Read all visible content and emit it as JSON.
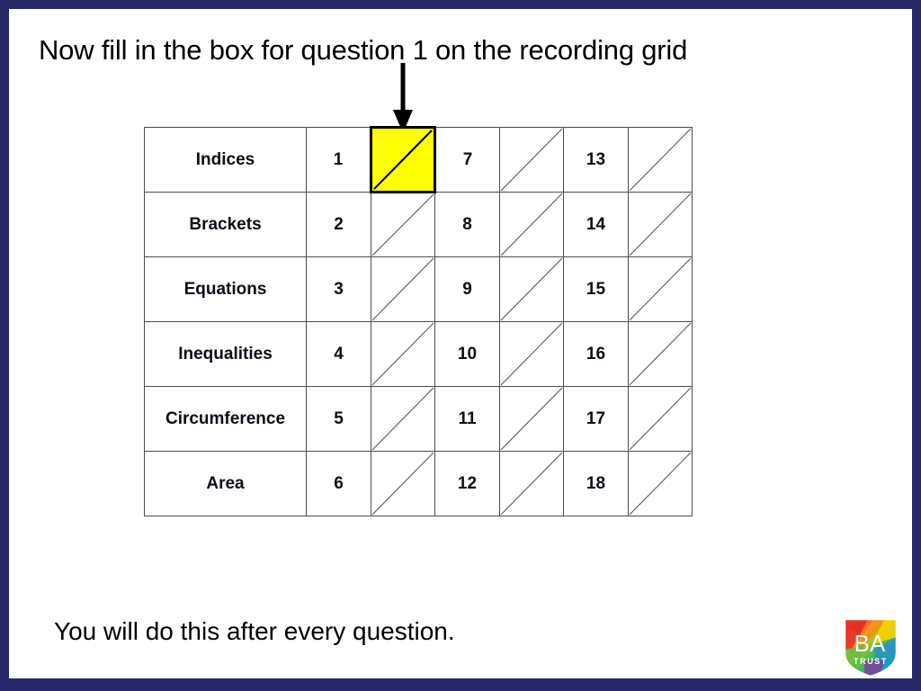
{
  "slide": {
    "headline": "Now fill in the box for question 1 on the recording grid",
    "footer_note": "You will do this after every question.",
    "border_color": "#27286a",
    "background_color": "#ffffff",
    "highlight_color": "#ffff00"
  },
  "arrow": {
    "name": "down-arrow",
    "points_to": "question-1-answer-cell"
  },
  "grid": {
    "rows": [
      {
        "topic": "Indices",
        "q1": "1",
        "a1": "",
        "q2": "7",
        "a2": "",
        "q3": "13",
        "a3": ""
      },
      {
        "topic": "Brackets",
        "q1": "2",
        "a1": "",
        "q2": "8",
        "a2": "",
        "q3": "14",
        "a3": ""
      },
      {
        "topic": "Equations",
        "q1": "3",
        "a1": "",
        "q2": "9",
        "a2": "",
        "q3": "15",
        "a3": ""
      },
      {
        "topic": "Inequalities",
        "q1": "4",
        "a1": "",
        "q2": "10",
        "a2": "",
        "q3": "16",
        "a3": ""
      },
      {
        "topic": "Circumference",
        "q1": "5",
        "a1": "",
        "q2": "11",
        "a2": "",
        "q3": "17",
        "a3": ""
      },
      {
        "topic": "Area",
        "q1": "6",
        "a1": "",
        "q2": "12",
        "a2": "",
        "q3": "18",
        "a3": ""
      }
    ],
    "highlighted_cell": {
      "row": 0,
      "column": "a1",
      "question_number": "1"
    }
  },
  "logo": {
    "name": "ba-trust-shield-logo",
    "primary_text": "BA",
    "secondary_text": "TRUST",
    "colors": [
      "#e3262a",
      "#f58220",
      "#ffd200",
      "#5bbb47",
      "#0fa8a0",
      "#2b8fd0",
      "#7d4199"
    ]
  }
}
